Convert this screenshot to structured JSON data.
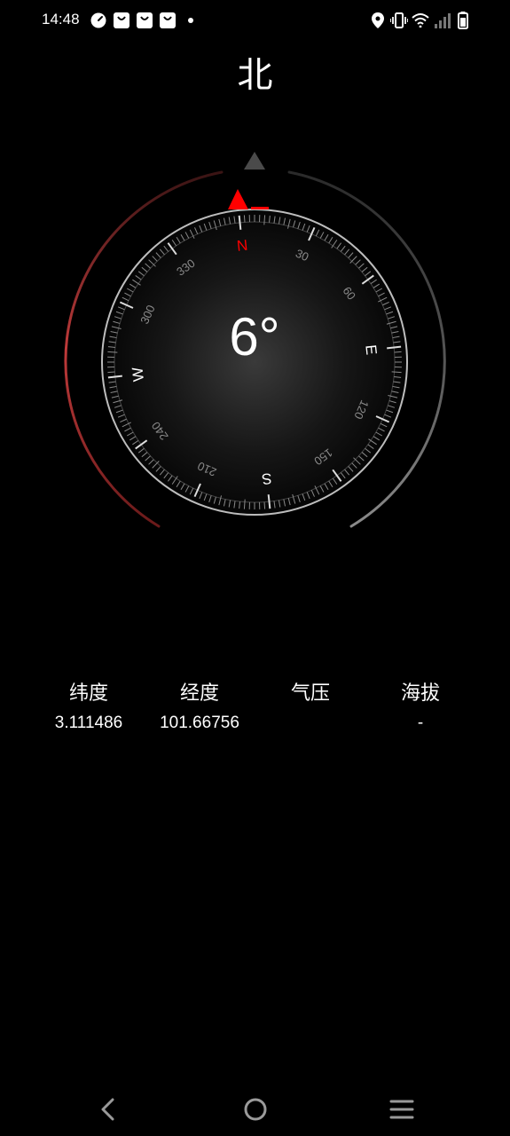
{
  "status_bar": {
    "time": "14:48",
    "icons": [
      "speedometer-icon",
      "shopping-bag-icon",
      "shopping-bag-icon",
      "shopping-bag-icon",
      "dot-icon",
      "location-icon",
      "vibrate-icon",
      "wifi-icon",
      "signal-icon",
      "battery-icon"
    ]
  },
  "compass": {
    "direction": "北",
    "degree": "6°",
    "cardinals": {
      "n": "N",
      "e": "E",
      "s": "S",
      "w": "W"
    },
    "dial_labels": [
      "30",
      "60",
      "120",
      "150",
      "210",
      "240",
      "300",
      "330"
    ],
    "accent_color": "#ff0000"
  },
  "info": {
    "latitude_label": "纬度",
    "latitude_value": "3.111486",
    "longitude_label": "经度",
    "longitude_value": "101.66756",
    "pressure_label": "气压",
    "pressure_value": "",
    "altitude_label": "海拔",
    "altitude_value": "-"
  },
  "nav": {
    "icons": [
      "back-icon",
      "home-icon",
      "menu-icon"
    ]
  }
}
